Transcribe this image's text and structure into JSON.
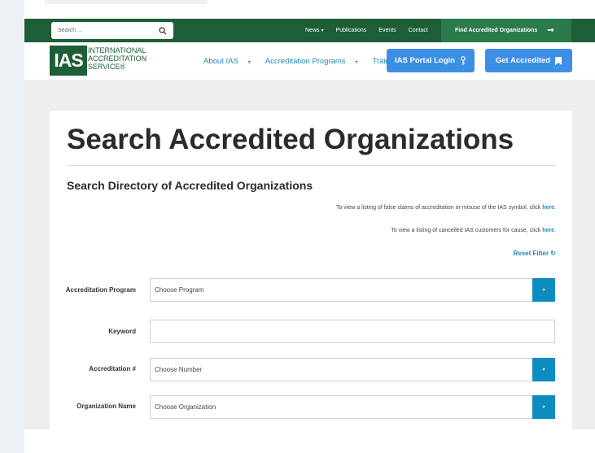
{
  "topbar": {
    "search_placeholder": "Search ...",
    "links": [
      "News",
      "Publications",
      "Events",
      "Contact"
    ],
    "find_button": "Find Accredited Organizations"
  },
  "logo": {
    "abbr": "IAS",
    "line1": "International",
    "line2": "Accreditation",
    "line3": "Service®"
  },
  "nav": {
    "items": [
      "About IAS",
      "Accreditation Programs",
      "Training"
    ],
    "portal_button": "IAS Portal Login",
    "get_button": "Get Accredited"
  },
  "page": {
    "title": "Search Accredited Organizations",
    "section_title": "Search Directory of Accredited Organizations",
    "note1_text": "To view a listing of false claims of accreditation or misuse of the IAS symbol, click",
    "note2_text": "To view a listing of cancelled IAS customers for cause, click",
    "here_link": "here",
    "reset_filter": "Reset Filter"
  },
  "filters": {
    "program_label": "Accreditation Program",
    "program_value": "Choose Program",
    "keyword_label": "Keyword",
    "keyword_value": "",
    "number_label": "Accreditation #",
    "number_value": "Choose Number",
    "org_label": "Organization Name",
    "org_value": "Choose Organization"
  },
  "colors": {
    "brand_green": "#1d5e37",
    "accent_blue": "#3d8fe6",
    "dropdown_blue": "#0c8cbf",
    "link_blue": "#1e88b5"
  },
  "icons": [
    "search-icon",
    "arrow-right-icon",
    "caret-down-icon",
    "key-icon",
    "bookmark-icon",
    "refresh-icon"
  ]
}
